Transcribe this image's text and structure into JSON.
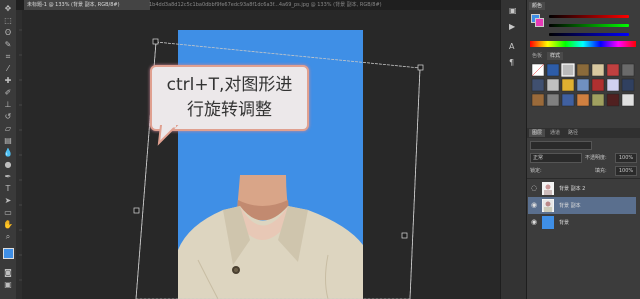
{
  "tabs": {
    "active": "未标题-1 @ 133% (背景 副本, RGB/8#)",
    "inactive": "1b4dd3a8d12c5c1ba0dbbf9fe67edc93a8f1dc6a3f...4a69_ps.jpg @ 133% (背景 副本, RGB/8#)"
  },
  "callout": {
    "line1": "ctrl+T,对图形进",
    "line2": "行旋转调整"
  },
  "panels": {
    "color_tab": "颜色",
    "swatches_tabs": [
      "色板",
      "样式"
    ],
    "layers_tabs": [
      "图层",
      "通道",
      "路径"
    ],
    "blend_mode": "正常",
    "opacity_label": "不透明度:",
    "opacity_value": "100%",
    "fill_label": "填充:",
    "fill_value": "100%",
    "lock_label": "锁定:"
  },
  "layers": [
    {
      "name": "背景 副本 2",
      "selected": false
    },
    {
      "name": "背景 副本",
      "selected": true
    },
    {
      "name": "背景",
      "selected": false
    }
  ],
  "colors": {
    "foreground": "#3f8fe6",
    "background": "#e83ab8",
    "document_bg": "#3f8fe6"
  }
}
